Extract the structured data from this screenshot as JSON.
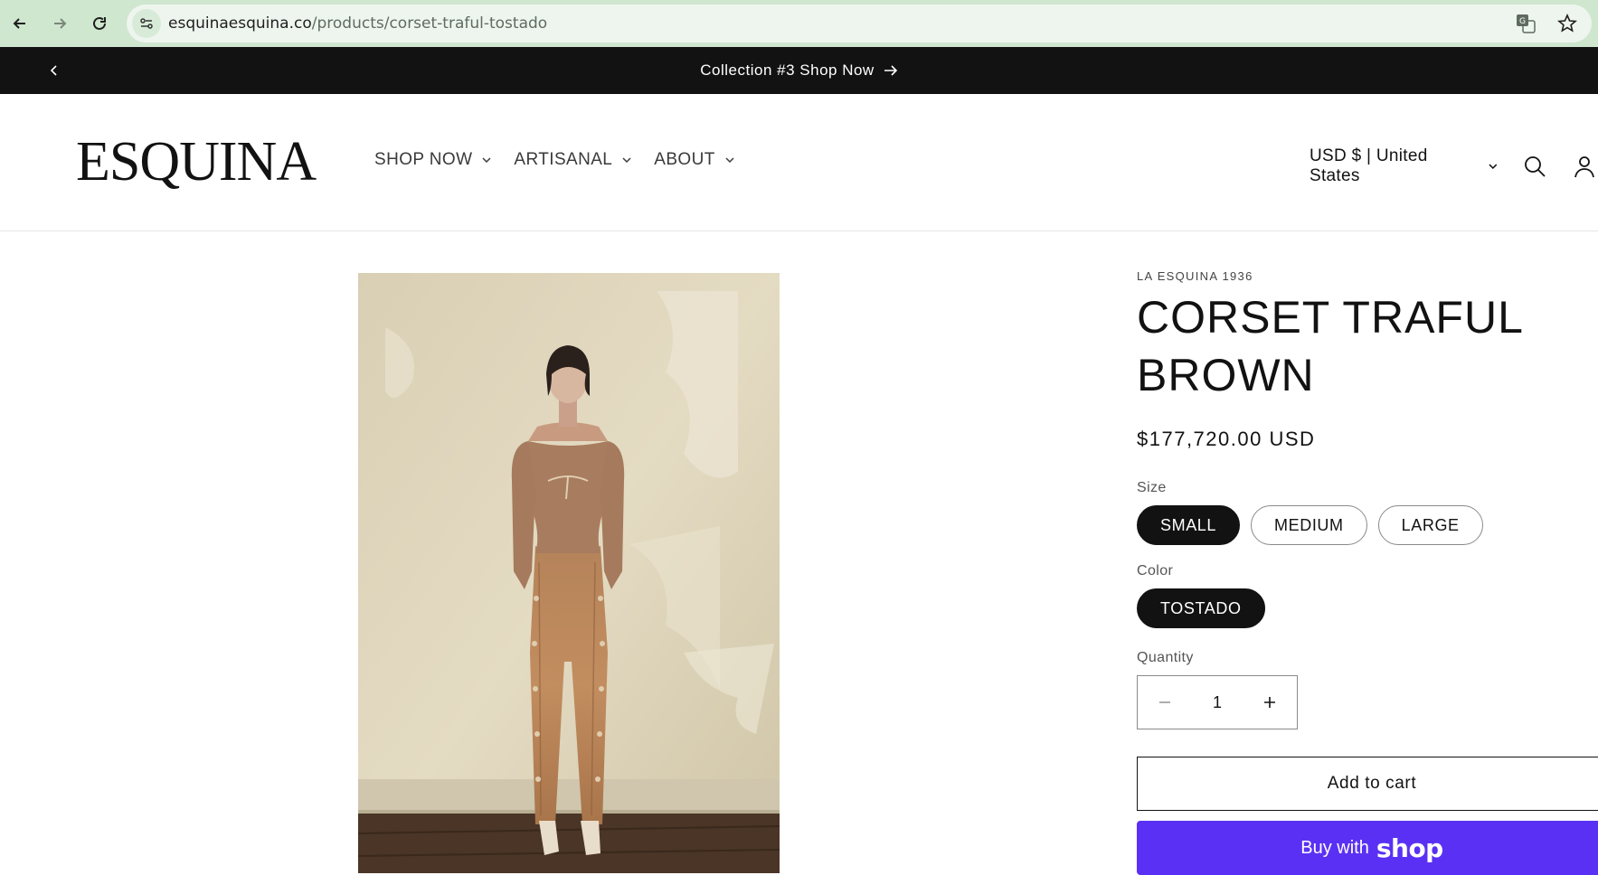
{
  "browser": {
    "url_domain": "esquinaesquina.co",
    "url_path": "/products/corset-traful-tostado"
  },
  "announcement": {
    "text": "Collection #3 Shop Now"
  },
  "header": {
    "logo": "ESQUINA",
    "nav": [
      {
        "label": "SHOP NOW"
      },
      {
        "label": "ARTISANAL"
      },
      {
        "label": "ABOUT"
      }
    ],
    "currency": "USD $ | United States"
  },
  "product": {
    "vendor": "LA ESQUINA 1936",
    "title_line1": "CORSET TRAFUL",
    "title_line2": "BROWN",
    "price": "$177,720.00 USD",
    "size_label": "Size",
    "sizes": [
      "SMALL",
      "MEDIUM",
      "LARGE"
    ],
    "selected_size": "SMALL",
    "color_label": "Color",
    "colors": [
      "TOSTADO"
    ],
    "selected_color": "TOSTADO",
    "quantity_label": "Quantity",
    "quantity": "1",
    "add_to_cart": "Add to cart",
    "buy_with": "Buy with",
    "shop_word": "shop"
  },
  "colors": {
    "announcement_bg": "#121212",
    "selected_pill": "#121212",
    "shop_pay": "#5a31f4",
    "browser_bar": "#cfe6cf"
  }
}
